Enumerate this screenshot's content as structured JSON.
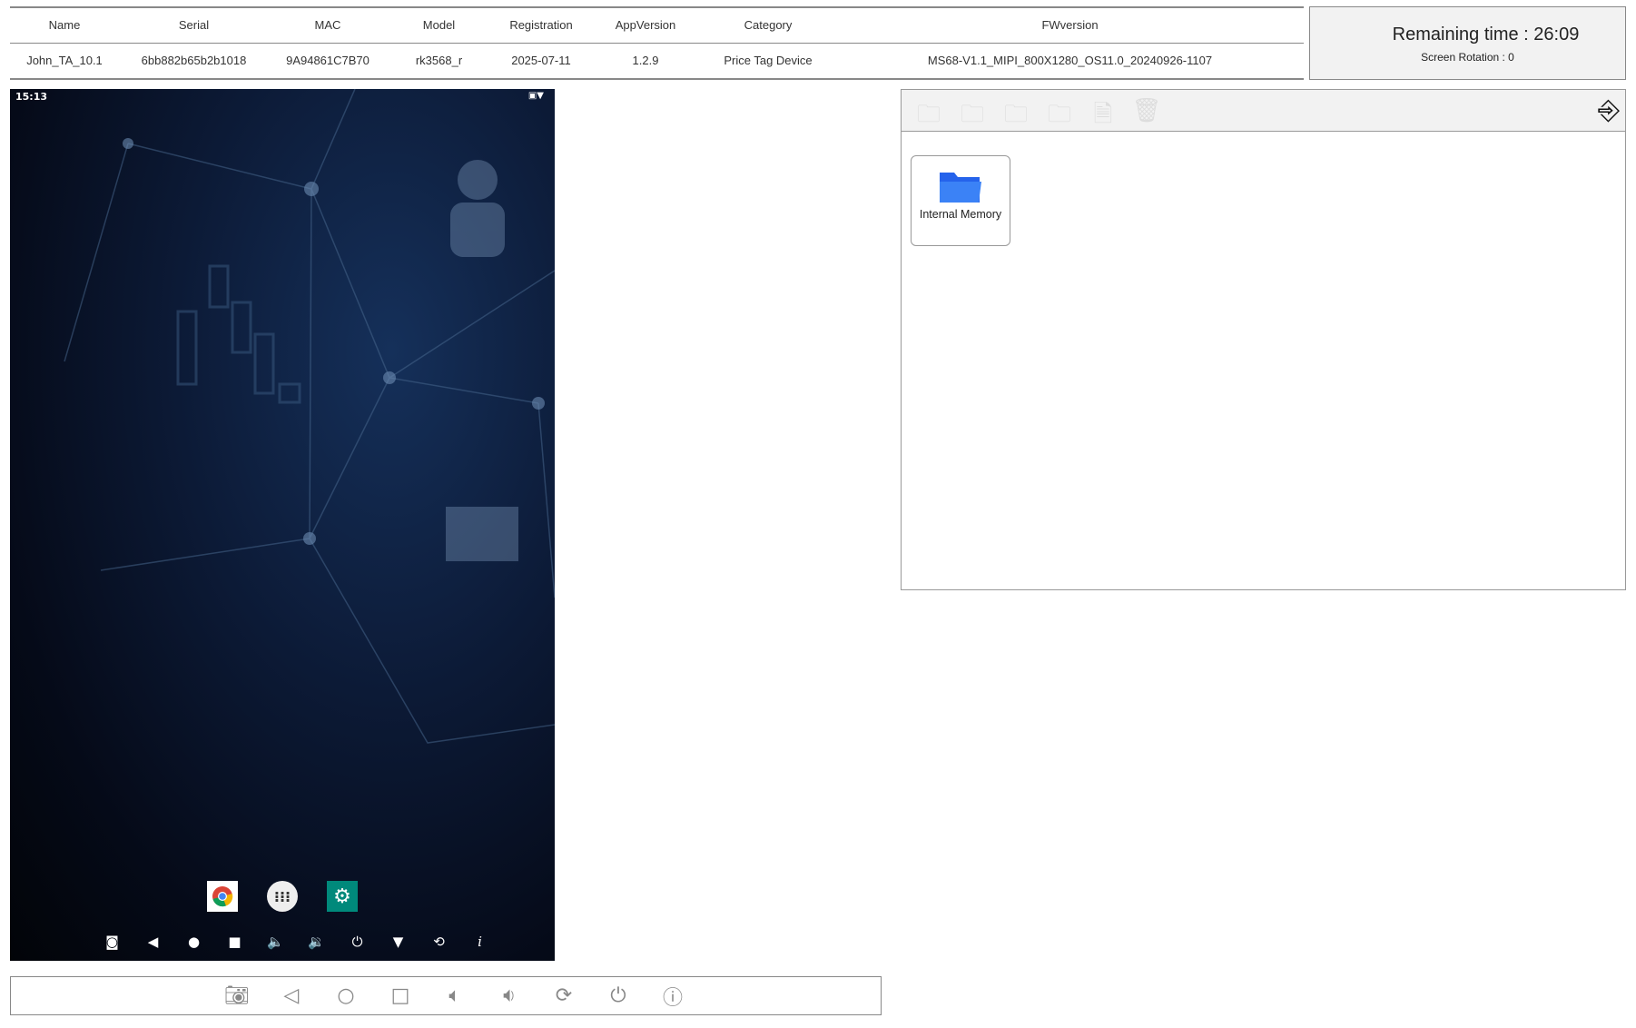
{
  "table": {
    "headers": [
      "Name",
      "Serial",
      "MAC",
      "Model",
      "Registration",
      "AppVersion",
      "Category",
      "FWversion"
    ],
    "row": [
      "John_TA_10.1",
      "6bb882b65b2b1018",
      "9A94861C7B70",
      "rk3568_r",
      "2025-07-11",
      "1.2.9",
      "Price Tag Device",
      "MS68-V1.1_MIPI_800X1280_OS11.0_20240926-1107"
    ]
  },
  "timer": {
    "remaining": "Remaining time : 26:09",
    "rotation": "Screen Rotation : 0"
  },
  "device": {
    "clock": "15:13",
    "apps": [
      "chrome",
      "app-drawer",
      "settings"
    ],
    "nav_icons": [
      "camera",
      "back",
      "home",
      "recents",
      "volume-down",
      "volume-up",
      "power",
      "notification",
      "rotate",
      "info"
    ]
  },
  "bottom_bar": {
    "icons": [
      "screenshot",
      "back",
      "home",
      "recents",
      "volume-down",
      "volume-up",
      "rotate",
      "power",
      "info"
    ]
  },
  "file_manager": {
    "toolbar": [
      "move",
      "download",
      "upload",
      "new-folder",
      "rename",
      "delete"
    ],
    "items": [
      {
        "label": "Internal Memory"
      }
    ],
    "accent": "#3b82f6"
  }
}
